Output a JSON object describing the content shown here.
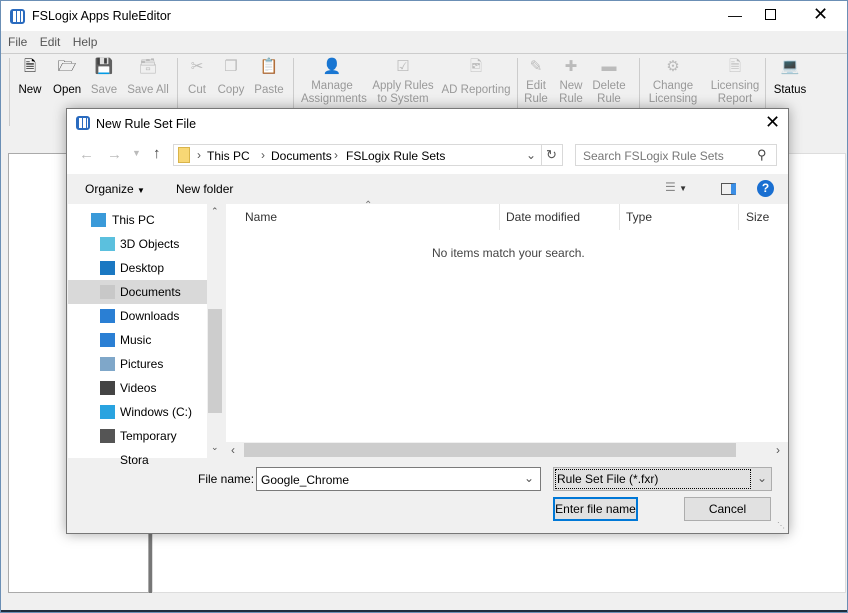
{
  "app": {
    "title": "FSLogix Apps RuleEditor",
    "menu": [
      "File",
      "Edit",
      "Help"
    ]
  },
  "toolbar": [
    {
      "label": "New",
      "icon": "new-file-icon",
      "enabled": true
    },
    {
      "label": "Open",
      "icon": "open-folder-icon",
      "enabled": true
    },
    {
      "label": "Save",
      "icon": "save-icon",
      "enabled": false
    },
    {
      "label": "Save All",
      "icon": "save-all-icon",
      "enabled": false
    },
    {
      "label": "Cut",
      "icon": "cut-icon",
      "enabled": false
    },
    {
      "label": "Copy",
      "icon": "copy-icon",
      "enabled": false
    },
    {
      "label": "Paste",
      "icon": "paste-icon",
      "enabled": false
    },
    {
      "label": "Manage Assignments",
      "icon": "user-icon",
      "enabled": false
    },
    {
      "label": "Apply Rules to System",
      "icon": "checkbox-icon",
      "enabled": false
    },
    {
      "label": "AD Reporting",
      "icon": "report-icon",
      "enabled": false
    },
    {
      "label": "Edit Rule",
      "icon": "edit-icon",
      "enabled": false
    },
    {
      "label": "New Rule",
      "icon": "plus-icon",
      "enabled": false
    },
    {
      "label": "Delete Rule",
      "icon": "minus-icon",
      "enabled": false
    },
    {
      "label": "Change Licensing",
      "icon": "gear-icon",
      "enabled": false
    },
    {
      "label": "Licensing Report",
      "icon": "document-icon",
      "enabled": false
    },
    {
      "label": "Status",
      "icon": "laptop-icon",
      "enabled": true
    }
  ],
  "dialog": {
    "title": "New Rule Set File",
    "breadcrumb": [
      "This PC",
      "Documents",
      "FSLogix Rule Sets"
    ],
    "search_placeholder": "Search FSLogix Rule Sets",
    "organize": "Organize",
    "new_folder": "New folder",
    "nav": [
      "This PC",
      "3D Objects",
      "Desktop",
      "Documents",
      "Downloads",
      "Music",
      "Pictures",
      "Videos",
      "Windows (C:)",
      "Temporary Stora"
    ],
    "nav_selected": "Documents",
    "columns": [
      "Name",
      "Date modified",
      "Type",
      "Size"
    ],
    "empty_message": "No items match your search.",
    "file_name_label": "File name:",
    "file_name": "Google_Chrome",
    "file_type": "Rule Set File (*.fxr)",
    "ok": "Enter file name",
    "cancel": "Cancel"
  }
}
